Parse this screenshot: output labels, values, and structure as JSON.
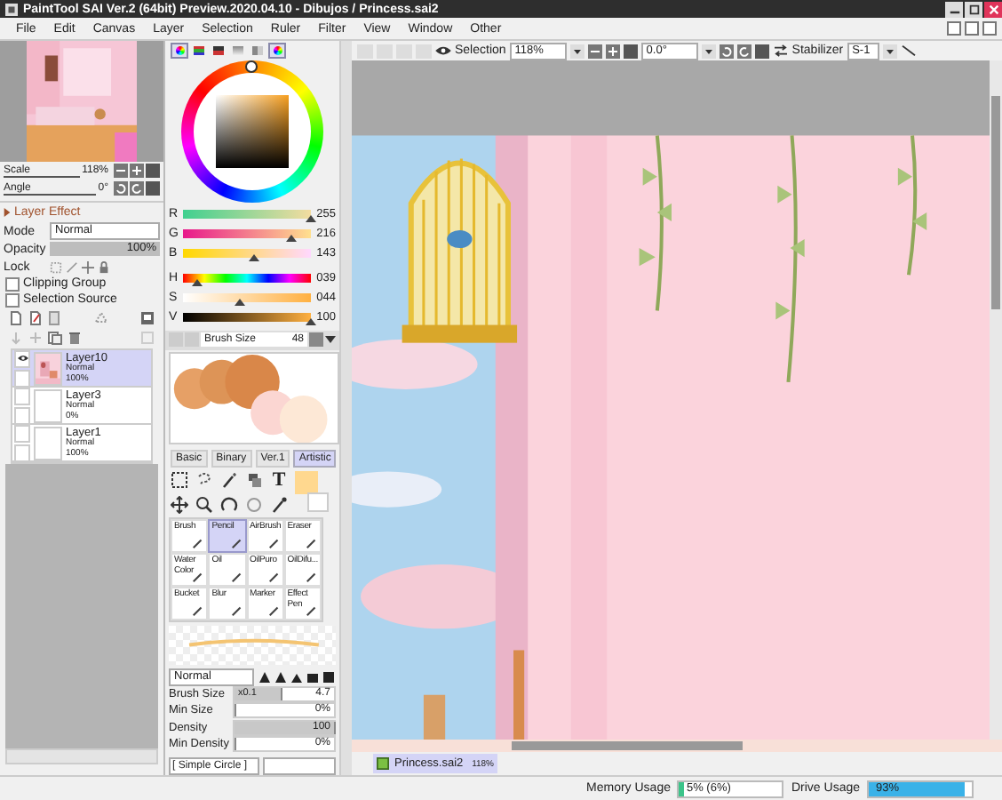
{
  "window": {
    "title": "PaintTool SAI Ver.2 (64bit) Preview.2020.04.10 - Dibujos / Princess.sai2"
  },
  "menu": [
    "File",
    "Edit",
    "Canvas",
    "Layer",
    "Selection",
    "Ruler",
    "Filter",
    "View",
    "Window",
    "Other"
  ],
  "navigator": {
    "scale_label": "Scale",
    "scale_value": "118%",
    "angle_label": "Angle",
    "angle_value": "0°"
  },
  "layer_panel": {
    "effect_label": "Layer Effect",
    "mode_label": "Mode",
    "mode_value": "Normal",
    "opacity_label": "Opacity",
    "opacity": {
      "value": "100%",
      "level": 1
    },
    "lock_label": "Lock",
    "options": [
      {
        "label": "Clipping Group",
        "checked": false
      },
      {
        "label": "Selection Source",
        "checked": false
      }
    ],
    "layers": [
      {
        "name": "Layer10",
        "mode": "Normal",
        "opacity": "100%",
        "selected": true,
        "visible": true,
        "kind": "picture"
      },
      {
        "name": "Layer3",
        "mode": "Normal",
        "opacity": "0%",
        "selected": false,
        "visible": false,
        "kind": "blank"
      },
      {
        "name": "Layer1",
        "mode": "Normal",
        "opacity": "100%",
        "selected": false,
        "visible": false,
        "kind": "blank"
      }
    ]
  },
  "color_panel": {
    "sliders": [
      {
        "label": "R",
        "value": "255",
        "level": 1
      },
      {
        "label": "G",
        "value": "216",
        "level": 0.85
      },
      {
        "label": "B",
        "value": "143",
        "level": 0.56
      },
      {
        "label": "H",
        "value": "039",
        "level": 0.11
      },
      {
        "label": "S",
        "value": "044",
        "level": 0.44
      },
      {
        "label": "V",
        "value": "100",
        "level": 1
      }
    ]
  },
  "preset": {
    "label": "Brush Size",
    "value": "48"
  },
  "tool_tabs": [
    {
      "label": "Basic",
      "selected": false
    },
    {
      "label": "Binary",
      "selected": false
    },
    {
      "label": "Ver.1",
      "selected": false
    },
    {
      "label": "Artistic",
      "selected": true
    }
  ],
  "text_tool_glyph": "T",
  "brushes": [
    {
      "label": "Brush",
      "selected": false
    },
    {
      "label": "Pencil",
      "selected": true
    },
    {
      "label": "AirBrush",
      "selected": false
    },
    {
      "label": "Eraser",
      "selected": false
    },
    {
      "label": "Water Color",
      "selected": false
    },
    {
      "label": "Oil",
      "selected": false
    },
    {
      "label": "OilPuro",
      "selected": false
    },
    {
      "label": "OilDifu...",
      "selected": false
    },
    {
      "label": "Bucket",
      "selected": false
    },
    {
      "label": "Blur",
      "selected": false
    },
    {
      "label": "Marker",
      "selected": false
    },
    {
      "label": "Effect Pen",
      "selected": false
    }
  ],
  "brush_settings": {
    "blend": "Normal",
    "rows": [
      {
        "label": "Brush Size",
        "multiplier": "x0.1",
        "value": "4.7",
        "level": 0.47
      },
      {
        "label": "Min Size",
        "value": "0%",
        "level": 0
      },
      {
        "label": "Density",
        "value": "100",
        "level": 1
      },
      {
        "label": "Min Density",
        "value": "0%",
        "level": 0
      }
    ],
    "texture": "[ Simple Circle ]"
  },
  "toolbar": {
    "selection_label": "Selection",
    "zoom": "118%",
    "angle": "0.0°",
    "stabilizer_label": "Stabilizer",
    "stabilizer": "S-1"
  },
  "document_tab": {
    "name": "Princess.sai2",
    "zoom": "118%"
  },
  "status_bar": {
    "memory": {
      "label": "Memory Usage",
      "value": "5% (6%)",
      "level": 0.05
    },
    "drive": {
      "label": "Drive Usage",
      "value": "93%",
      "level": 0.93
    }
  }
}
